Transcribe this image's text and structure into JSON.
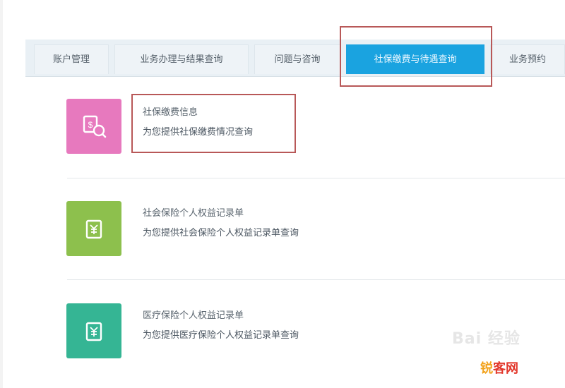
{
  "tabs": [
    {
      "label": "账户管理",
      "active": false
    },
    {
      "label": "业务办理与结果查询",
      "active": false
    },
    {
      "label": "问题与咨询",
      "active": false
    },
    {
      "label": "社保缴费与待遇查询",
      "active": true
    },
    {
      "label": "业务预约",
      "active": false
    }
  ],
  "cards": [
    {
      "title": "社保缴费信息",
      "desc": "为您提供社保缴费情况查询",
      "color": "#e779be",
      "icon": "fee-query-icon"
    },
    {
      "title": "社会保险个人权益记录单",
      "desc": "为您提供社会保险个人权益记录单查询",
      "color": "#8dc04d",
      "icon": "document-icon"
    },
    {
      "title": "医疗保险个人权益记录单",
      "desc": "为您提供医疗保险个人权益记录单查询",
      "color": "#35b594",
      "icon": "document-icon"
    }
  ],
  "colors": {
    "accent": "#1aa3e0",
    "highlight_box": "#b85858"
  },
  "watermark": "Bai 经验",
  "site_logo": {
    "part1": "锐",
    "part2": "客网"
  }
}
